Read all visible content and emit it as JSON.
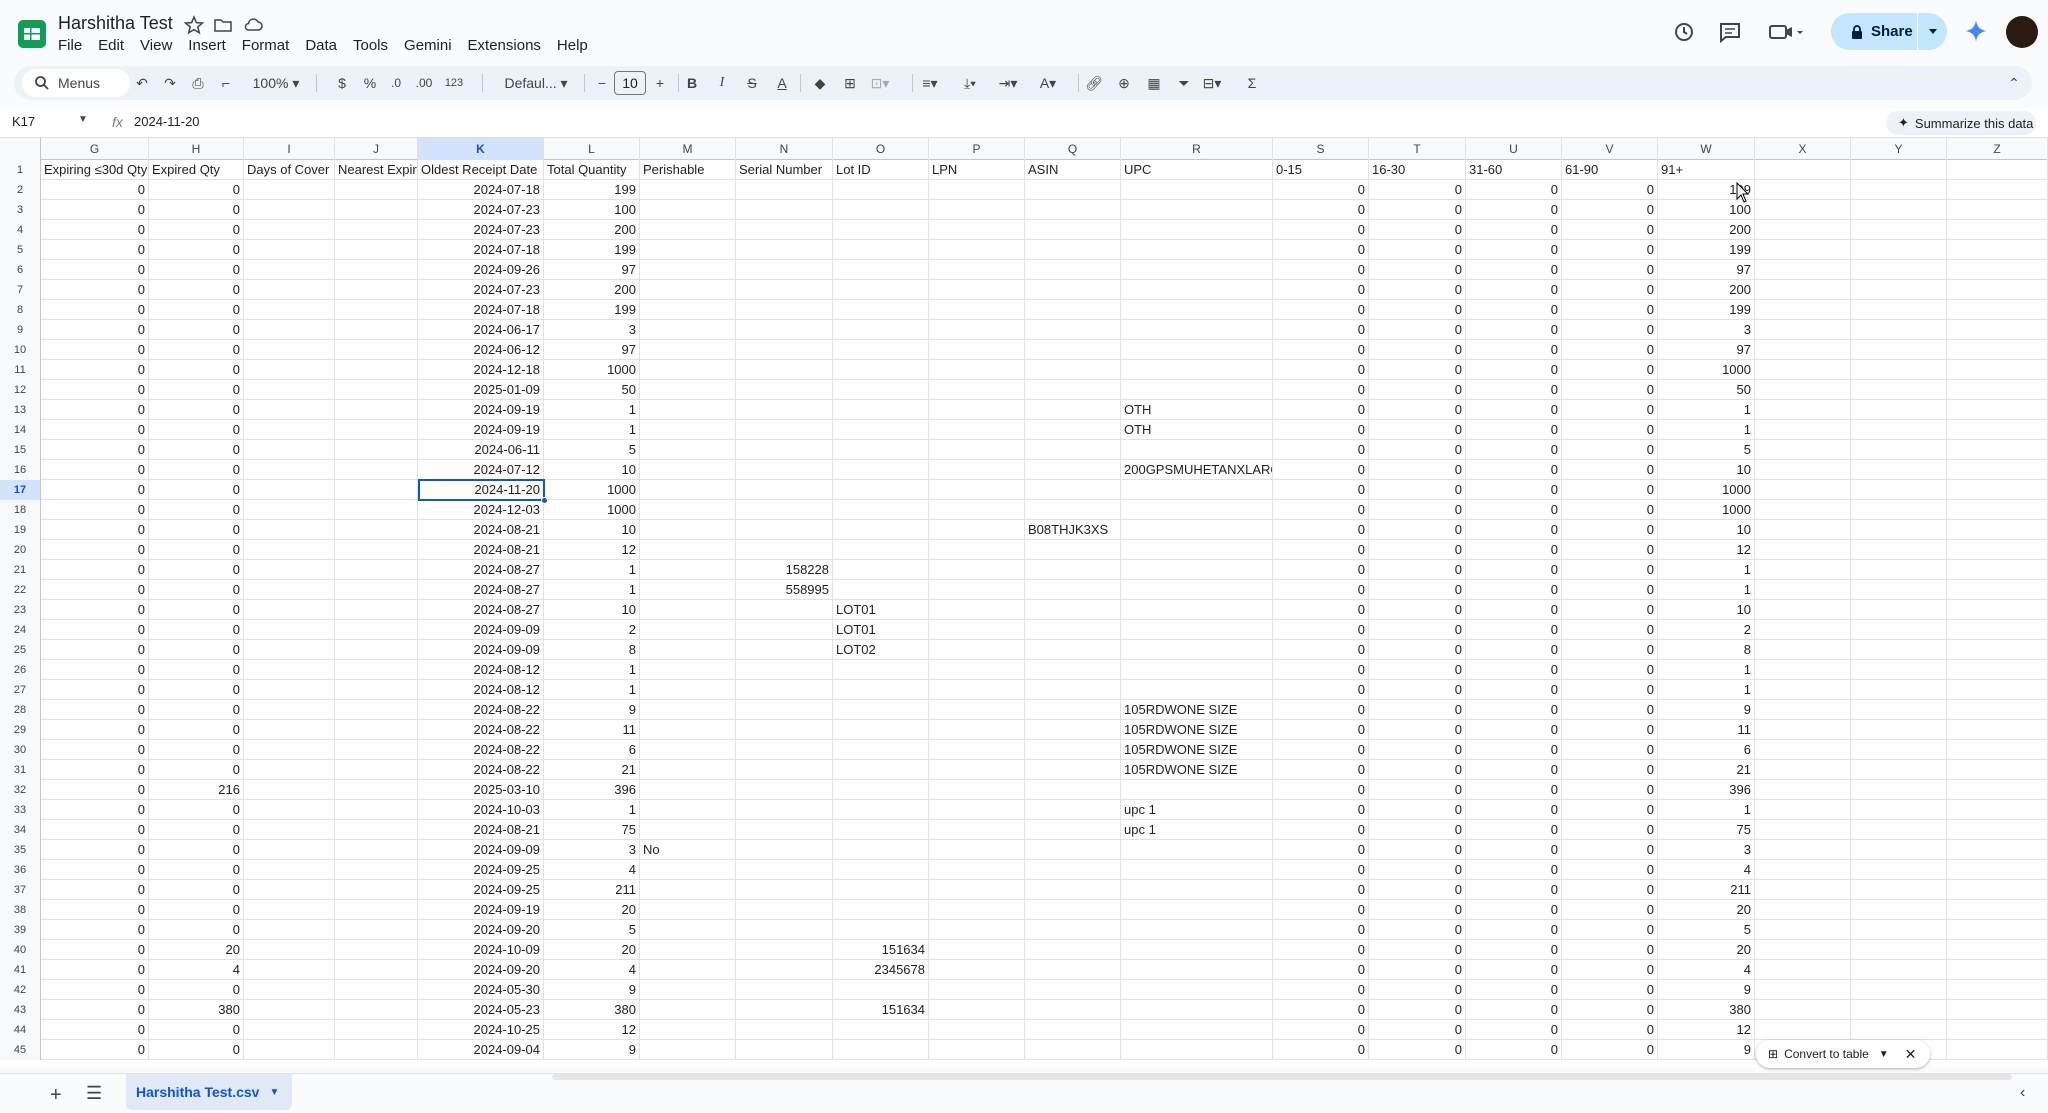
{
  "app": {
    "doc_title": "Harshitha Test",
    "menu": [
      "File",
      "Edit",
      "View",
      "Insert",
      "Format",
      "Data",
      "Tools",
      "Gemini",
      "Extensions",
      "Help"
    ],
    "share_label": "Share"
  },
  "toolbar": {
    "menus_label": "Menus",
    "zoom": "100%",
    "currency": "$",
    "percent": "%",
    "dec_decrease": ".0",
    "dec_increase": ".00",
    "number_format": "123",
    "font": "Defaul...",
    "font_size": "10",
    "bold": "B",
    "italic": "I",
    "sigma": "Σ"
  },
  "formula_bar": {
    "cell_ref": "K17",
    "fx": "fx",
    "value": "2024-11-20",
    "summarize": "Summarize this data"
  },
  "columns": [
    "G",
    "H",
    "I",
    "J",
    "K",
    "L",
    "M",
    "N",
    "O",
    "P",
    "Q",
    "R",
    "S",
    "T",
    "U",
    "V",
    "W",
    "X",
    "Y",
    "Z"
  ],
  "selected_column": "K",
  "selected_row": 17,
  "header_row": {
    "G": "Expiring ≤30d Qty",
    "H": "Expired Qty",
    "I": "Days of Cover",
    "J": "Nearest Expiry",
    "K": "Oldest Receipt Date",
    "L": "Total Quantity",
    "M": "Perishable",
    "N": "Serial Number",
    "O": "Lot ID",
    "P": "LPN",
    "Q": "ASIN",
    "R": "UPC",
    "S": "0-15",
    "T": "16-30",
    "U": "31-60",
    "V": "61-90",
    "W": "91+"
  },
  "rows": [
    {
      "n": 2,
      "G": "0",
      "H": "0",
      "K": "2024-07-18",
      "L": "199",
      "W": "199"
    },
    {
      "n": 3,
      "G": "0",
      "H": "0",
      "K": "2024-07-23",
      "L": "100",
      "W": "100"
    },
    {
      "n": 4,
      "G": "0",
      "H": "0",
      "K": "2024-07-23",
      "L": "200",
      "W": "200"
    },
    {
      "n": 5,
      "G": "0",
      "H": "0",
      "K": "2024-07-18",
      "L": "199",
      "W": "199"
    },
    {
      "n": 6,
      "G": "0",
      "H": "0",
      "K": "2024-09-26",
      "L": "97",
      "W": "97"
    },
    {
      "n": 7,
      "G": "0",
      "H": "0",
      "K": "2024-07-23",
      "L": "200",
      "W": "200"
    },
    {
      "n": 8,
      "G": "0",
      "H": "0",
      "K": "2024-07-18",
      "L": "199",
      "W": "199"
    },
    {
      "n": 9,
      "G": "0",
      "H": "0",
      "K": "2024-06-17",
      "L": "3",
      "W": "3"
    },
    {
      "n": 10,
      "G": "0",
      "H": "0",
      "K": "2024-06-12",
      "L": "97",
      "W": "97"
    },
    {
      "n": 11,
      "G": "0",
      "H": "0",
      "K": "2024-12-18",
      "L": "1000",
      "W": "1000"
    },
    {
      "n": 12,
      "G": "0",
      "H": "0",
      "K": "2025-01-09",
      "L": "50",
      "W": "50"
    },
    {
      "n": 13,
      "G": "0",
      "H": "0",
      "K": "2024-09-19",
      "L": "1",
      "R": "OTH",
      "W": "1"
    },
    {
      "n": 14,
      "G": "0",
      "H": "0",
      "K": "2024-09-19",
      "L": "1",
      "R": "OTH",
      "W": "1"
    },
    {
      "n": 15,
      "G": "0",
      "H": "0",
      "K": "2024-06-11",
      "L": "5",
      "W": "5"
    },
    {
      "n": 16,
      "G": "0",
      "H": "0",
      "K": "2024-07-12",
      "L": "10",
      "R": "200GPSMUHETANXLARG",
      "W": "10"
    },
    {
      "n": 17,
      "G": "0",
      "H": "0",
      "K": "2024-11-20",
      "L": "1000",
      "W": "1000"
    },
    {
      "n": 18,
      "G": "0",
      "H": "0",
      "K": "2024-12-03",
      "L": "1000",
      "W": "1000"
    },
    {
      "n": 19,
      "G": "0",
      "H": "0",
      "K": "2024-08-21",
      "L": "10",
      "Q": "B08THJK3XS",
      "W": "10"
    },
    {
      "n": 20,
      "G": "0",
      "H": "0",
      "K": "2024-08-21",
      "L": "12",
      "W": "12"
    },
    {
      "n": 21,
      "G": "0",
      "H": "0",
      "K": "2024-08-27",
      "L": "1",
      "N": "158228",
      "W": "1"
    },
    {
      "n": 22,
      "G": "0",
      "H": "0",
      "K": "2024-08-27",
      "L": "1",
      "N": "558995",
      "W": "1"
    },
    {
      "n": 23,
      "G": "0",
      "H": "0",
      "K": "2024-08-27",
      "L": "10",
      "O": "LOT01",
      "W": "10"
    },
    {
      "n": 24,
      "G": "0",
      "H": "0",
      "K": "2024-09-09",
      "L": "2",
      "O": "LOT01",
      "W": "2"
    },
    {
      "n": 25,
      "G": "0",
      "H": "0",
      "K": "2024-09-09",
      "L": "8",
      "O": "LOT02",
      "W": "8"
    },
    {
      "n": 26,
      "G": "0",
      "H": "0",
      "K": "2024-08-12",
      "L": "1",
      "W": "1"
    },
    {
      "n": 27,
      "G": "0",
      "H": "0",
      "K": "2024-08-12",
      "L": "1",
      "W": "1"
    },
    {
      "n": 28,
      "G": "0",
      "H": "0",
      "K": "2024-08-22",
      "L": "9",
      "R": "105RDWONE SIZE",
      "W": "9"
    },
    {
      "n": 29,
      "G": "0",
      "H": "0",
      "K": "2024-08-22",
      "L": "11",
      "R": "105RDWONE SIZE",
      "W": "11"
    },
    {
      "n": 30,
      "G": "0",
      "H": "0",
      "K": "2024-08-22",
      "L": "6",
      "R": "105RDWONE SIZE",
      "W": "6"
    },
    {
      "n": 31,
      "G": "0",
      "H": "0",
      "K": "2024-08-22",
      "L": "21",
      "R": "105RDWONE SIZE",
      "W": "21"
    },
    {
      "n": 32,
      "G": "0",
      "H": "216",
      "K": "2025-03-10",
      "L": "396",
      "W": "396"
    },
    {
      "n": 33,
      "G": "0",
      "H": "0",
      "K": "2024-10-03",
      "L": "1",
      "R": "upc 1",
      "W": "1"
    },
    {
      "n": 34,
      "G": "0",
      "H": "0",
      "K": "2024-08-21",
      "L": "75",
      "R": "upc 1",
      "W": "75"
    },
    {
      "n": 35,
      "G": "0",
      "H": "0",
      "K": "2024-09-09",
      "L": "3",
      "M": "No",
      "W": "3"
    },
    {
      "n": 36,
      "G": "0",
      "H": "0",
      "K": "2024-09-25",
      "L": "4",
      "W": "4"
    },
    {
      "n": 37,
      "G": "0",
      "H": "0",
      "K": "2024-09-25",
      "L": "211",
      "W": "211"
    },
    {
      "n": 38,
      "G": "0",
      "H": "0",
      "K": "2024-09-19",
      "L": "20",
      "W": "20"
    },
    {
      "n": 39,
      "G": "0",
      "H": "0",
      "K": "2024-09-20",
      "L": "5",
      "W": "5"
    },
    {
      "n": 40,
      "G": "0",
      "H": "20",
      "K": "2024-10-09",
      "L": "20",
      "O": "151634",
      "W": "20"
    },
    {
      "n": 41,
      "G": "0",
      "H": "4",
      "K": "2024-09-20",
      "L": "4",
      "O": "2345678",
      "W": "4"
    },
    {
      "n": 42,
      "G": "0",
      "H": "0",
      "K": "2024-05-30",
      "L": "9",
      "W": "9"
    },
    {
      "n": 43,
      "G": "0",
      "H": "380",
      "K": "2024-05-23",
      "L": "380",
      "O": "151634",
      "W": "380"
    },
    {
      "n": 44,
      "G": "0",
      "H": "0",
      "K": "2024-10-25",
      "L": "12",
      "W": "12"
    },
    {
      "n": 45,
      "G": "0",
      "H": "0",
      "K": "2024-09-04",
      "L": "9",
      "W": "9"
    }
  ],
  "bucket_zero": "0",
  "sheet_tab": "Harshitha Test.csv",
  "convert_chip": "Convert to table",
  "colors": {
    "accent": "#0b57d0",
    "share_bg": "#c2e7ff",
    "sheets_green": "#0f9d58"
  }
}
